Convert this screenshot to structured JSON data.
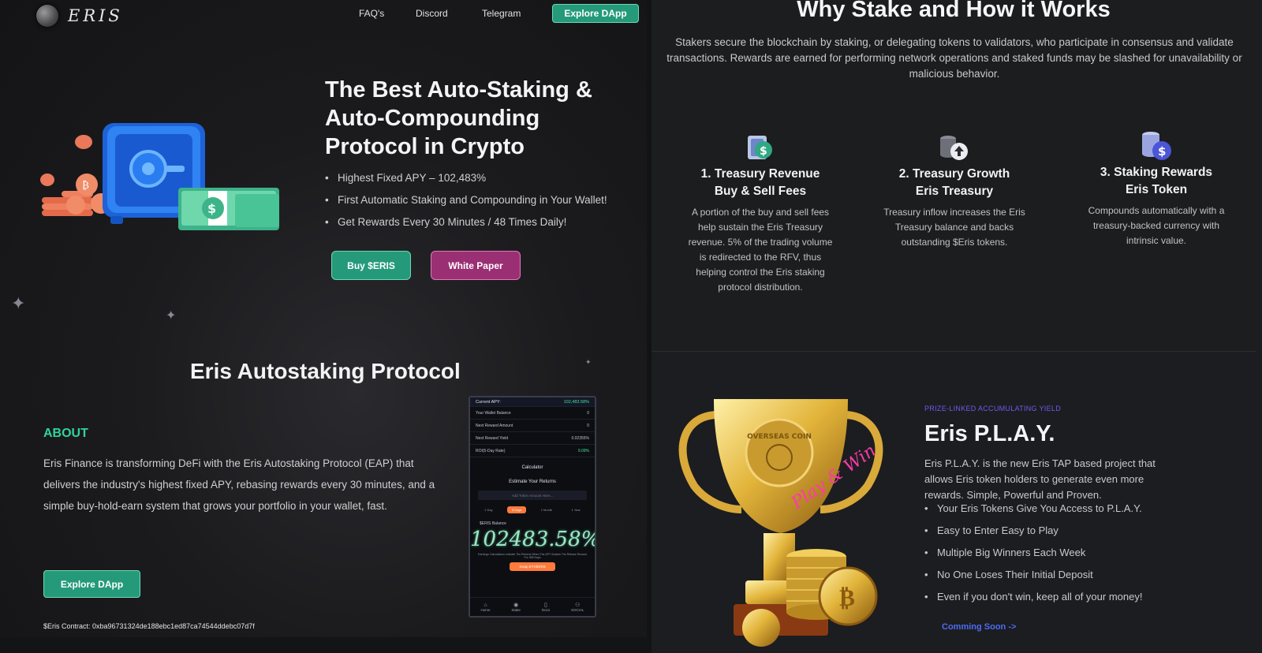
{
  "brand": {
    "name": "ERIS"
  },
  "nav": {
    "faq": "FAQ's",
    "discord": "Discord",
    "telegram": "Telegram",
    "explore": "Explore DApp"
  },
  "hero": {
    "title": "The Best Auto-Staking & Auto-Compounding Protocol in Crypto",
    "bullets": [
      "Highest Fixed APY – 102,483%",
      "First Automatic Staking and Compounding in Your Wallet!",
      "Get Rewards Every 30 Minutes / 48 Times Daily!"
    ],
    "buy_label": "Buy $ERIS",
    "whitepaper_label": "White Paper"
  },
  "protocol": {
    "title": "Eris Autostaking Protocol",
    "about_label": "ABOUT",
    "about_text": "Eris Finance is transforming DeFi with the Eris Autostaking Protocol (EAP) that delivers the industry's highest fixed APY, rebasing rewards every 30 minutes, and a simple buy-hold-earn system that grows your portfolio in your wallet, fast.",
    "explore_label": "Explore DApp",
    "contract": "$Eris Contract: 0xba96731324de188ebc1ed87ca74544ddebc07d7f"
  },
  "phone": {
    "apy_label": "Current APY:",
    "apy_value": "102,483.58%",
    "rows": [
      "Your Wallet Balance",
      "Next Reward Amount",
      "Next Reward Yield",
      "ROI(5-Day Rate)"
    ],
    "row_values": [
      "0",
      "0",
      "0.02355%",
      "9.09%"
    ],
    "calculator": "Calculator",
    "estimate": "Estimate Your Returns",
    "input_placeholder": "Add Token Amount Here...",
    "pills": [
      "1 Day",
      "5 Days",
      "1 Month",
      "1 Year"
    ],
    "balance_label": "$ERIS Balance",
    "big_value": "102483.58%",
    "fine": "Earnings Calculations Indicate The Returns When The APY Sustain The Rebase Reward For 365 Days",
    "swap": "Swap ETH/ERIS",
    "tabs": [
      "Home",
      "Stake",
      "Docs",
      "SOCIAL"
    ]
  },
  "why": {
    "title": "Why Stake and How it Works",
    "text": "Stakers secure the blockchain by staking, or delegating tokens to validators, who participate in consensus and validate transactions. Rewards are earned for performing network operations and staked funds may be slashed for unavailability or malicious behavior.",
    "features": [
      {
        "t1": "1. Treasury Revenue",
        "t2": "Buy & Sell Fees",
        "desc": "A portion of the buy and sell fees help sustain the Eris Treasury revenue. 5% of the trading volume is redirected to the RFV, thus helping control the Eris staking protocol distribution.",
        "icon": "dollar-cash-icon"
      },
      {
        "t1": "2. Treasury Growth",
        "t2": "Eris Treasury",
        "desc": "Treasury inflow increases the Eris Treasury balance and backs outstanding $Eris tokens.",
        "icon": "coins-upload-icon"
      },
      {
        "t1": "3. Staking Rewards",
        "t2": "Eris Token",
        "desc": "Compounds automatically with a treasury-backed currency with intrinsic value.",
        "icon": "coin-stack-dollar-icon"
      }
    ]
  },
  "play": {
    "tag": "PRIZE-LINKED ACCUMULATING YIELD",
    "title": "Eris P.L.A.Y.",
    "text": "Eris P.L.A.Y. is the new Eris TAP based project that allows Eris token holders to generate even more rewards. Simple, Powerful and Proven.",
    "bullets": [
      "Your Eris Tokens Give You Access to P.L.A.Y.",
      "Easy to Enter Easy to Play",
      "Multiple Big Winners Each Week",
      "No One Loses Their Initial Deposit",
      "Even if you don't win, keep all of your money!"
    ],
    "coming": "Comming Soon ->",
    "trophy_text": "Play & Win",
    "coin_text": "OVERSEAS COIN"
  },
  "colors": {
    "accent_green": "#249a7a",
    "accent_magenta": "#9a2f74",
    "about_green": "#2fd59a",
    "link_blue": "#4c6cf5"
  }
}
